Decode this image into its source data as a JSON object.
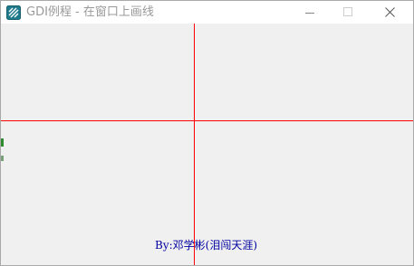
{
  "window": {
    "title": "GDI例程 - 在窗口上画线",
    "icon": "app-icon",
    "controls": {
      "minimize": "minimize-icon",
      "maximize": "maximize-icon",
      "close": "close-icon"
    }
  },
  "canvas": {
    "background": "#f0f0f0",
    "line_color": "#ff0000",
    "credit_text": "By:邓学彬(泪闯天涯)",
    "credit_color": "#0000a0"
  }
}
